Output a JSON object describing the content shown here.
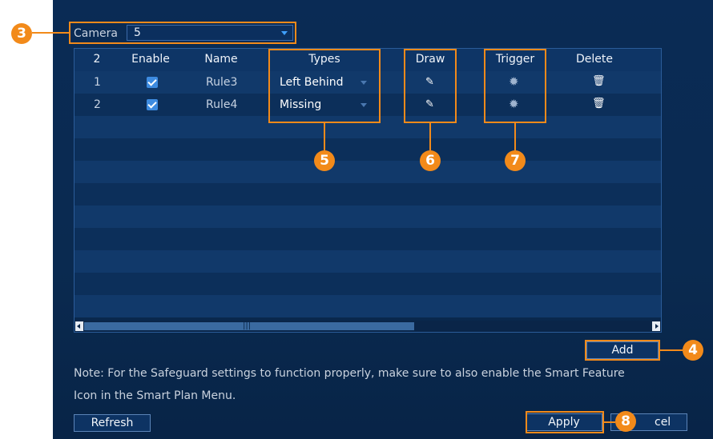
{
  "camera": {
    "label": "Camera",
    "value": "5"
  },
  "table": {
    "headers": [
      "2",
      "Enable",
      "Name",
      "Types",
      "Draw",
      "Trigger",
      "Delete"
    ],
    "rows": [
      {
        "index": "1",
        "enabled": true,
        "name": "Rule3",
        "type": "Left Behind"
      },
      {
        "index": "2",
        "enabled": true,
        "name": "Rule4",
        "type": "Missing"
      }
    ]
  },
  "buttons": {
    "add": "Add",
    "refresh": "Refresh",
    "apply": "Apply",
    "cancel_partial": "cel"
  },
  "note": {
    "line1": "Note: For the Safeguard settings to function properly, make sure to also enable the Smart Feature",
    "line2": "Icon in the Smart Plan Menu."
  },
  "callouts": [
    "3",
    "4",
    "5",
    "6",
    "7",
    "8"
  ],
  "colors": {
    "accent": "#f28a1a",
    "panel": "#0a2b55",
    "checkbox": "#3d8be0"
  }
}
